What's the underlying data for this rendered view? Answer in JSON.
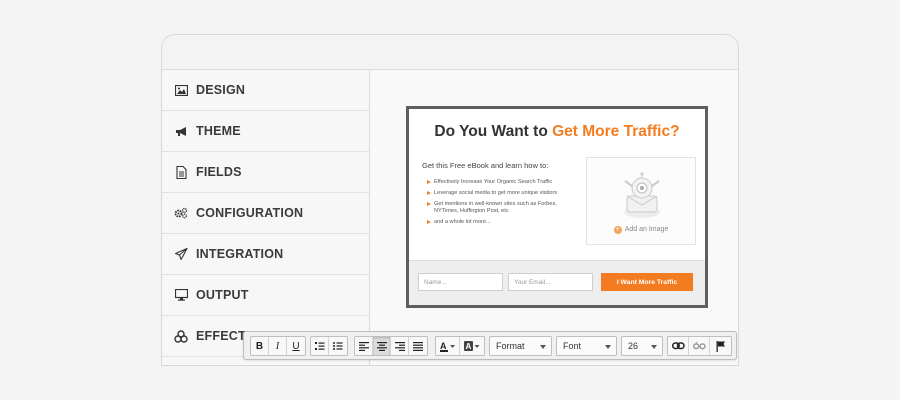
{
  "sidebar": {
    "items": [
      {
        "label": "DESIGN",
        "icon": "image-icon"
      },
      {
        "label": "THEME",
        "icon": "megaphone-icon"
      },
      {
        "label": "FIELDS",
        "icon": "document-icon"
      },
      {
        "label": "CONFIGURATION",
        "icon": "gears-icon"
      },
      {
        "label": "INTEGRATION",
        "icon": "paper-plane-icon"
      },
      {
        "label": "OUTPUT",
        "icon": "monitor-icon"
      },
      {
        "label": "EFFECTS",
        "icon": "effects-icon"
      }
    ]
  },
  "optin": {
    "title_plain": "Do You Want to ",
    "title_accent": "Get More Traffic?",
    "intro": "Get this Free eBook and learn how to:",
    "bullets": [
      "Effectively Increase Your Organic Search Traffic",
      "Leverage social media to get more unique visitors",
      "Get mentions in well-known sites such as Forbes, NYTimes, Huffington Post, etc",
      "and a whole lot more..."
    ],
    "add_image_label": "Add an Image",
    "name_placeholder": "Name...",
    "email_placeholder": "Your Email...",
    "cta_label": "I Want More Traffic",
    "accent_color": "#f47c20"
  },
  "toolbar": {
    "bold": "B",
    "italic": "I",
    "underline": "U",
    "format_label": "Format",
    "font_label": "Font",
    "size_label": "26"
  }
}
